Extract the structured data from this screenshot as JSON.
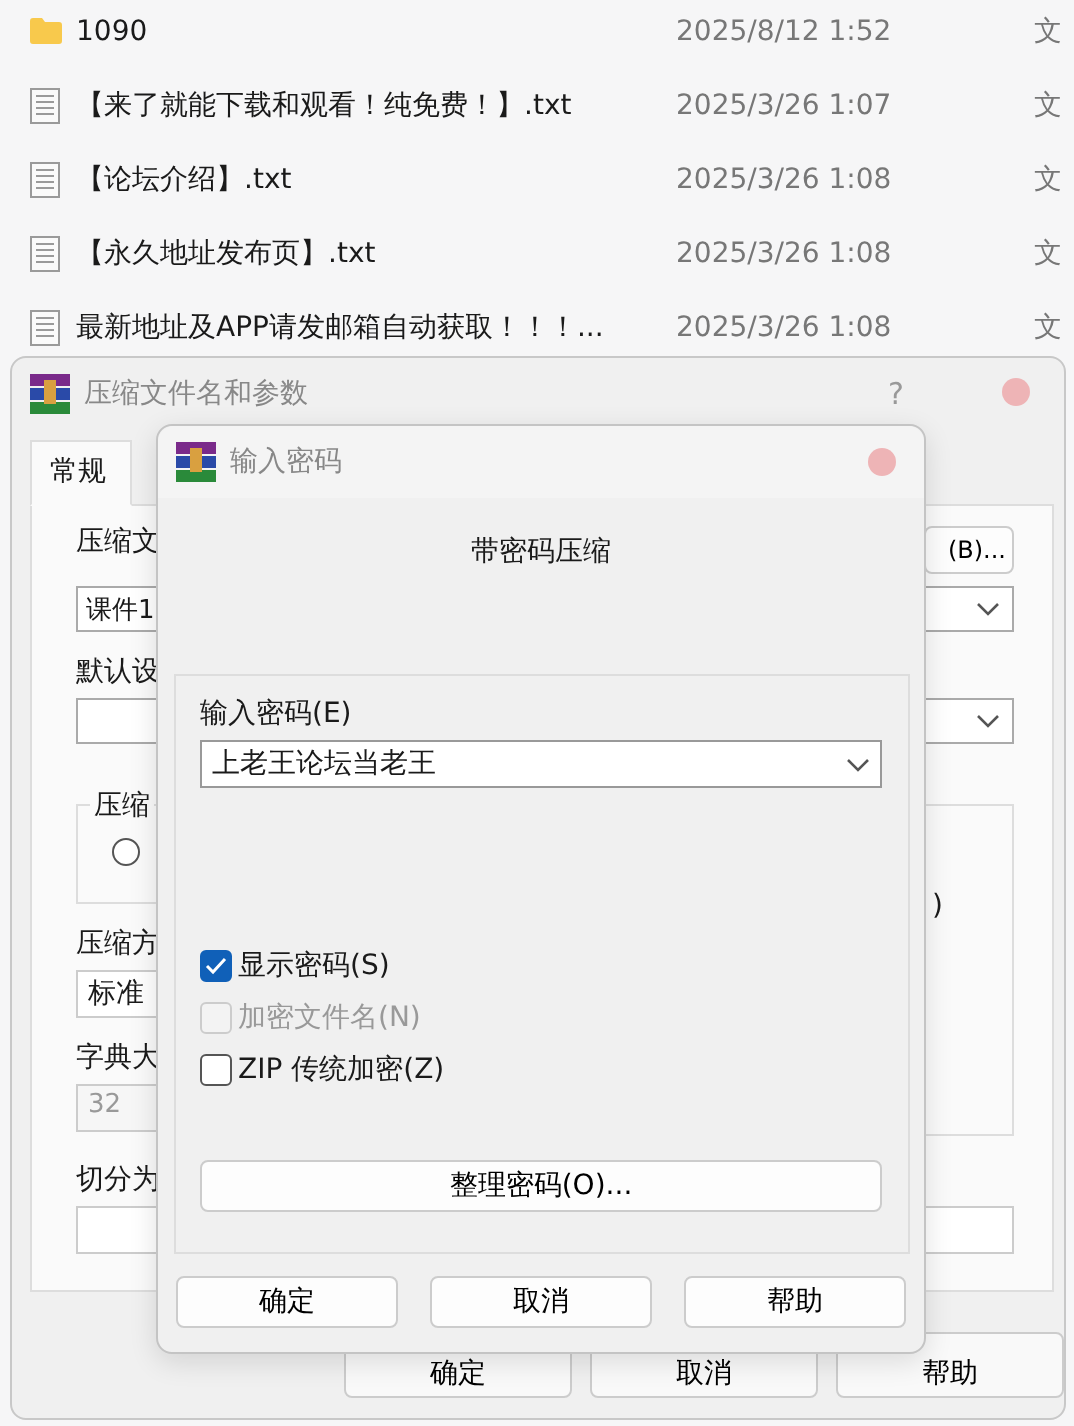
{
  "file_list": {
    "rows": [
      {
        "kind": "folder",
        "name": "1090",
        "date": "2025/8/12 1:52",
        "type": "文"
      },
      {
        "kind": "text_file",
        "name": "【来了就能下载和观看！纯免费！】.txt",
        "date": "2025/3/26 1:07",
        "type": "文"
      },
      {
        "kind": "text_file",
        "name": "【论坛介绍】.txt",
        "date": "2025/3/26 1:08",
        "type": "文"
      },
      {
        "kind": "text_file",
        "name": "【永久地址发布页】.txt",
        "date": "2025/3/26 1:08",
        "type": "文"
      },
      {
        "kind": "text_file",
        "name": "最新地址及APP请发邮箱自动获取！！！...",
        "date": "2025/3/26 1:08",
        "type": "文"
      }
    ]
  },
  "archive_dialog": {
    "title": "压缩文件名和参数",
    "help": "?",
    "tabs": [
      {
        "label": "常规",
        "selected": true
      }
    ],
    "archive_name_label": "压缩文",
    "browse_button": "(B)...",
    "archive_name_value": "课件1",
    "profile_label": "默认设",
    "format_group": {
      "title": "压缩",
      "radio_selected": false
    },
    "method_label": "压缩方",
    "method_value": "标准",
    "dictionary_label": "字典大",
    "dictionary_value": "32",
    "options_group_text": ")",
    "split_label": "切分为",
    "buttons": [
      "确定",
      "取消",
      "帮助"
    ]
  },
  "password_dialog": {
    "title": "输入密码",
    "heading": "带密码压缩",
    "password_label": "输入密码(E)",
    "password_value": "上老王论坛当老王",
    "options": [
      {
        "label": "显示密码(S)",
        "checked": true,
        "disabled": false
      },
      {
        "label": "加密文件名(N)",
        "checked": false,
        "disabled": true
      },
      {
        "label": "ZIP 传统加密(Z)",
        "checked": false,
        "disabled": false
      }
    ],
    "organize_button": "整理密码(O)...",
    "buttons": [
      "确定",
      "取消",
      "帮助"
    ]
  }
}
